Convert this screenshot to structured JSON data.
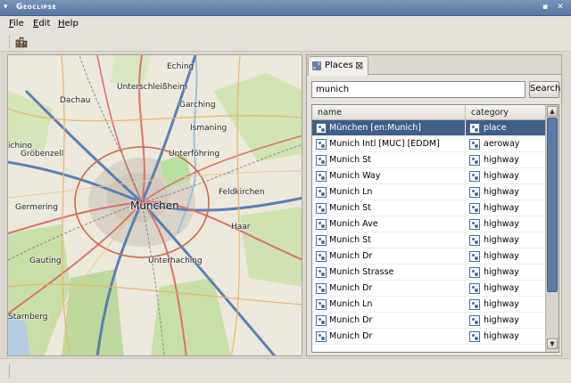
{
  "window": {
    "title": "Geoclipse",
    "menu_glyph": "▾",
    "btn_min": "▪",
    "btn_close": "✕"
  },
  "menu": [
    {
      "mnemonic": "F",
      "rest": "ile"
    },
    {
      "mnemonic": "E",
      "rest": "dit"
    },
    {
      "mnemonic": "H",
      "rest": "elp"
    }
  ],
  "map": {
    "labels": {
      "eching": "Eching",
      "unterschleissheim": "Unterschleißheim",
      "dachau": "Dachau",
      "garching": "Garching",
      "ismaning": "Ismaning",
      "eichenau": "ichino",
      "groebenzell": "Gröbenzell",
      "unterfoehring": "Unterföhring",
      "feldkirchen": "Feldkirchen",
      "germering": "Germering",
      "muenchen": "München",
      "haar": "Haar",
      "gauting": "Gauting",
      "unterhaching": "Unterhaching",
      "starnberg": "Starnberg"
    }
  },
  "panel": {
    "tab_label": "Places",
    "tab_close": "⊠",
    "search_value": "munich",
    "search_button": "Search",
    "columns": {
      "name": "name",
      "category": "category"
    },
    "scroll_up": "▲",
    "scroll_down": "▼",
    "rows": [
      {
        "name": "München [en:Munich]",
        "category": "place",
        "selected": true
      },
      {
        "name": "Munich Intl [MUC] [EDDM]",
        "category": "aeroway"
      },
      {
        "name": "Munich St",
        "category": "highway"
      },
      {
        "name": "Munich Way",
        "category": "highway"
      },
      {
        "name": "Munich Ln",
        "category": "highway"
      },
      {
        "name": "Munich St",
        "category": "highway"
      },
      {
        "name": "Munich Ave",
        "category": "highway"
      },
      {
        "name": "Munich St",
        "category": "highway"
      },
      {
        "name": "Munich Dr",
        "category": "highway"
      },
      {
        "name": "Munich Strasse",
        "category": "highway"
      },
      {
        "name": "Munich Dr",
        "category": "highway"
      },
      {
        "name": "Munich Ln",
        "category": "highway"
      },
      {
        "name": "Munich Dr",
        "category": "highway"
      },
      {
        "name": "Munich Dr",
        "category": "highway"
      }
    ]
  }
}
